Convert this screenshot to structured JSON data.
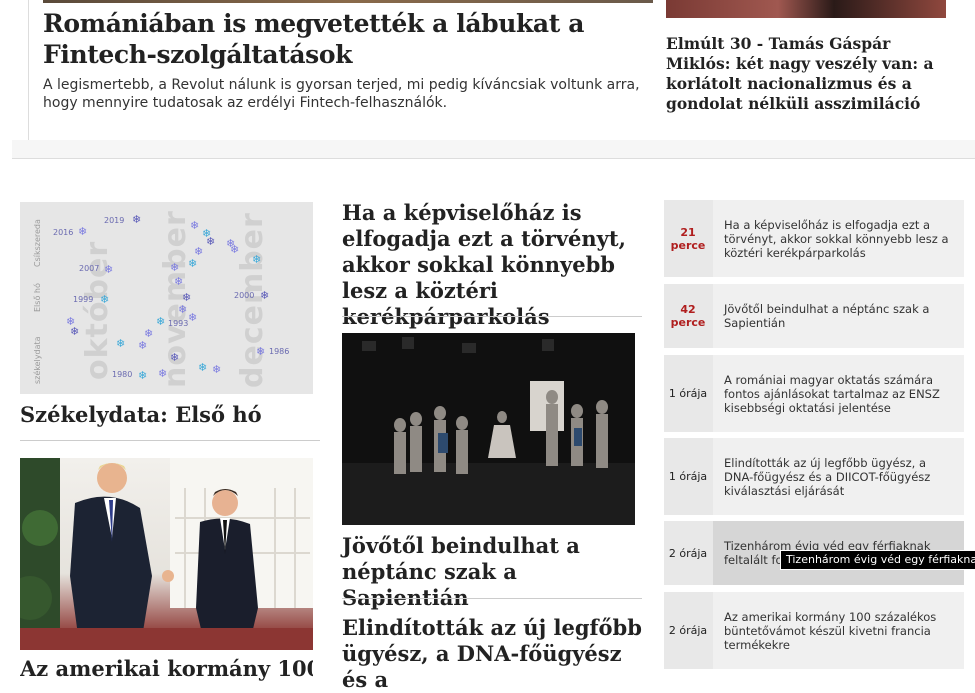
{
  "top": {
    "lead_title": "Romániában is megvetették a lábukat a Fintech-szolgáltatások",
    "lead_excerpt": "A legismertebb, a Revolut nálunk is gyorsan terjed, mi pedig kíváncsiak voltunk arra, hogy mennyire tudatosak az erdélyi Fintech-felhasználók.",
    "side_title": "Elmúlt 30 - Tamás Gáspár Miklós: két nagy veszély van: a korlátolt nacionalizmus és a gondolat nélküli asszimiláció"
  },
  "column1": {
    "infographic": {
      "months": [
        "október",
        "november",
        "december"
      ],
      "labels": [
        "Csíkszereda",
        "Első hó",
        "székelydata"
      ],
      "years": [
        "2019",
        "2016",
        "2007",
        "1999",
        "1993",
        "2000",
        "1986",
        "1980"
      ]
    },
    "title": "Székelydata: Első hó",
    "bottom_title": "Az amerikai kormány 100"
  },
  "column2": {
    "title_1": "Ha a képviselőház is elfogadja ezt a törvényt, akkor sokkal könnyebb lesz a köztéri kerékpárparkolás",
    "title_2": "Jövőtől beindulhat a néptánc szak a Sapientián",
    "title_3": "Elindították az új legfőbb ügyész, a DNA-főügyész és a"
  },
  "feed": {
    "items": [
      {
        "time": "21 perce",
        "text": "Ha a képviselőház is elfogadja ezt a törvényt, akkor sokkal könnyebb lesz a köztéri kerékpárparkolás"
      },
      {
        "time": "42 perce",
        "text": "Jövőtől beindulhat a néptánc szak a Sapientián"
      },
      {
        "time": "1 órája",
        "text": "A romániai magyar oktatás számára fontos ajánlásokat tartalmaz az ENSZ kisebbségi oktatási jelentése"
      },
      {
        "time": "1 órája",
        "text": "Elindították az új legfőbb ügyész, a DNA-főügyész és a DIICOT-főügyész kiválasztási eljárását"
      },
      {
        "time": "2 órája",
        "text": "Tizenhárom évig véd egy férfiaknak feltalált fo"
      },
      {
        "time": "2 órája",
        "text": "Az amerikai kormány 100 százalékos büntetővámot készül kivetni francia termékekre"
      }
    ],
    "tooltip": "Tizenhárom évig véd egy férfiaknak"
  },
  "colors": {
    "feed_bg": "#e8e8e8",
    "recent_time": "#b01e1e",
    "month_watermark": "#d0d0d0",
    "snowflake": "#7c7ce0"
  }
}
